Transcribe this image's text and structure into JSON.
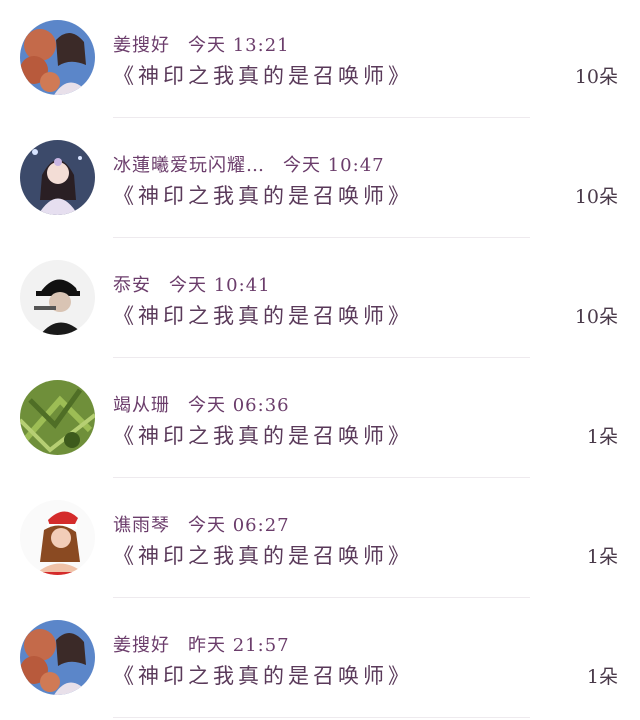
{
  "gifts": [
    {
      "name": "姜搜好",
      "time": "今天 13:21",
      "title": "《神印之我真的是召唤师》",
      "count": "10朵",
      "avatar_icon": "avatar-girl-flowers-icon"
    },
    {
      "name": "冰蓮曦爱玩闪耀…",
      "time": "今天 10:47",
      "title": "《神印之我真的是召唤师》",
      "count": "10朵",
      "avatar_icon": "avatar-anime-girl-icon"
    },
    {
      "name": "忝安",
      "time": "今天 10:41",
      "title": "《神印之我真的是召唤师》",
      "count": "10朵",
      "avatar_icon": "avatar-man-cap-icon"
    },
    {
      "name": "竭从珊",
      "time": "今天 06:36",
      "title": "《神印之我真的是召唤师》",
      "count": "1朵",
      "avatar_icon": "avatar-green-plant-icon"
    },
    {
      "name": "谯雨琴",
      "time": "今天 06:27",
      "title": "《神印之我真的是召唤师》",
      "count": "1朵",
      "avatar_icon": "avatar-santa-girl-icon"
    },
    {
      "name": "姜搜好",
      "time": "昨天 21:57",
      "title": "《神印之我真的是召唤师》",
      "count": "1朵",
      "avatar_icon": "avatar-girl-flowers-icon"
    }
  ]
}
